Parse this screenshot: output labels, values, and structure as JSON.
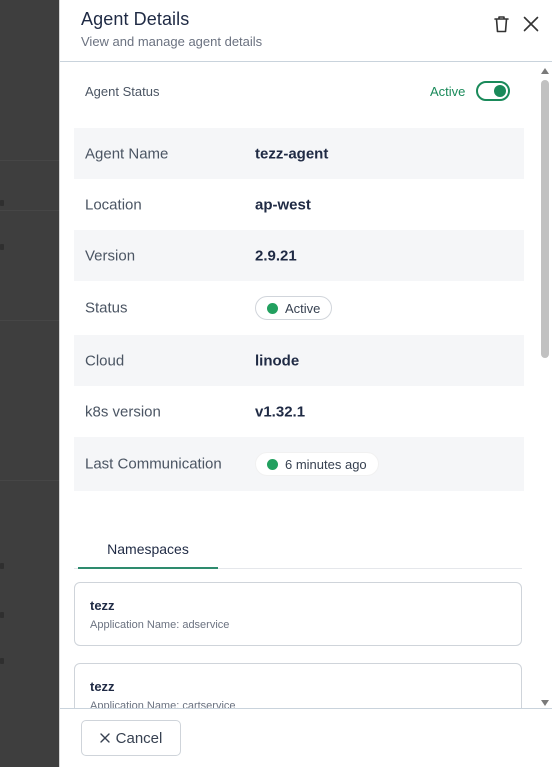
{
  "header": {
    "title": "Agent Details",
    "subtitle": "View and manage agent details",
    "delete_icon": "trash-icon",
    "close_icon": "close-icon"
  },
  "agent_status": {
    "label": "Agent Status",
    "value": "Active",
    "enabled": true
  },
  "details": [
    {
      "label": "Agent Name",
      "value": "tezz-agent"
    },
    {
      "label": "Location",
      "value": "ap-west"
    },
    {
      "label": "Version",
      "value": "2.9.21"
    },
    {
      "label": "Status",
      "value": "Active"
    },
    {
      "label": "Cloud",
      "value": "linode"
    },
    {
      "label": "k8s version",
      "value": "v1.32.1"
    },
    {
      "label": "Last Communication",
      "value": "6 minutes ago"
    }
  ],
  "tabs": [
    {
      "label": "Namespaces",
      "active": true
    }
  ],
  "namespaces": [
    {
      "name": "tezz",
      "application": "Application Name: adservice"
    },
    {
      "name": "tezz",
      "application": "Application Name: cartservice"
    }
  ],
  "footer": {
    "cancel_label": "Cancel"
  },
  "colors": {
    "accent": "#1a8a5a",
    "status_dot": "#22a05f",
    "title_text": "#1f2a44"
  }
}
